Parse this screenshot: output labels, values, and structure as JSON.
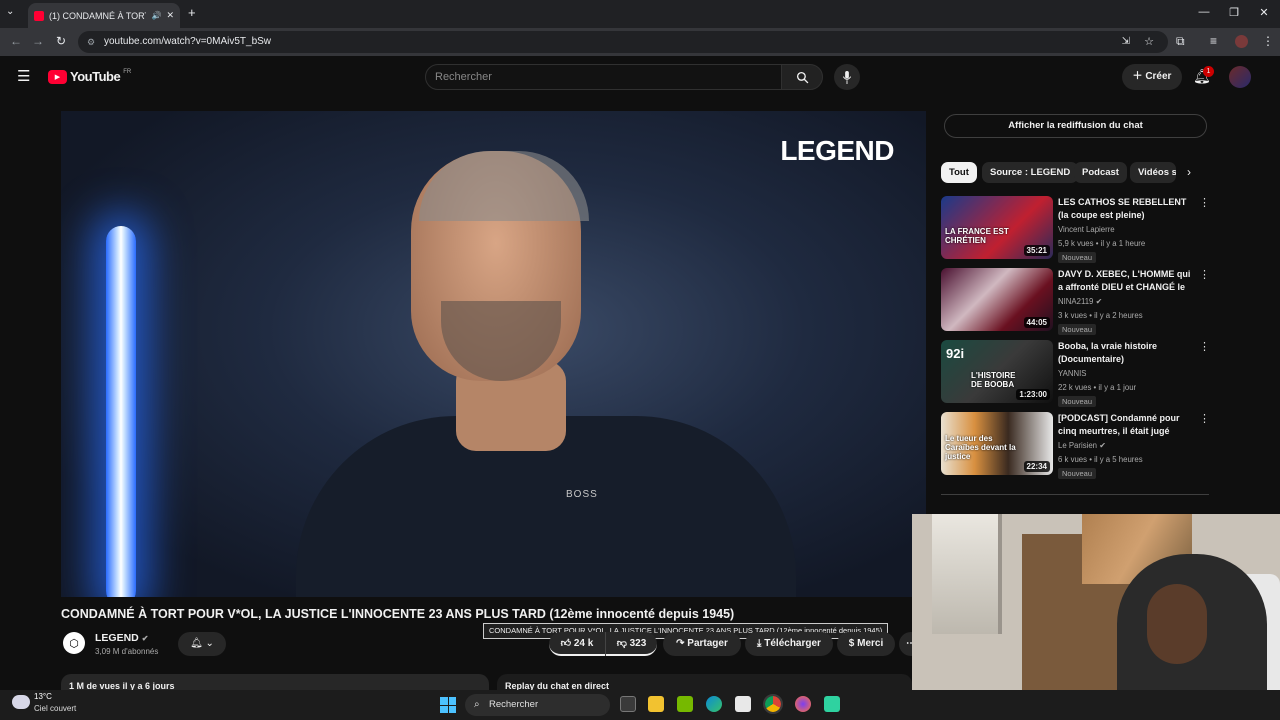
{
  "browser": {
    "tab_title": "(1) CONDAMNÉ À TORT PO",
    "url": "youtube.com/watch?v=0MAiv5T_bSw"
  },
  "youtube": {
    "logo_text": "YouTube",
    "region": "FR",
    "search_placeholder": "Rechercher",
    "create_label": "Créer",
    "notif_count": "1"
  },
  "video": {
    "overlay_logo": "LEGEND",
    "shirt_text": "BOSS",
    "title": "CONDAMNÉ À TORT POUR V*OL, LA JUSTICE L'INNOCENTE 23 ANS PLUS TARD (12ème innocenté depuis 1945)",
    "tooltip": "CONDAMNÉ À TORT POUR V*OL, LA JUSTICE L'INNOCENTE 23 ANS PLUS TARD (12ème innocenté depuis 1945)",
    "channel": "LEGEND",
    "subscribers": "3,09 M d'abonnés",
    "likes": "24 k",
    "dislikes": "323",
    "share": "Partager",
    "download": "Télécharger",
    "thanks": "Merci",
    "views_date": "1 M de vues  il y a 6 jours",
    "chat_replay": "Replay du chat en direct"
  },
  "sidebar": {
    "chat_button": "Afficher la rediffusion du chat",
    "chips": [
      "Tout",
      "Source : LEGEND",
      "Podcast",
      "Vidéos s"
    ],
    "recommendations": [
      {
        "title": "LES CATHOS SE REBELLENT (la coupe est pleine)",
        "channel": "Vincent Lapierre",
        "views": "5,9 k vues • il y a 1 heure",
        "badge": "Nouveau",
        "duration": "35:21",
        "thumb_text": "LA FRANCE EST CHRÉTIEN"
      },
      {
        "title": "DAVY D. XEBEC, L'HOMME qui a affronté DIEU et CHANGÉ le ...",
        "channel": "NINA2119",
        "views": "3 k vues • il y a 2 heures",
        "badge": "Nouveau",
        "duration": "44:05",
        "thumb_text": ""
      },
      {
        "title": "Booba, la vraie histoire (Documentaire)",
        "channel": "YANNIS",
        "views": "22 k vues • il y a 1 jour",
        "badge": "Nouveau",
        "duration": "1:23:00",
        "thumb_text": "L'HISTOIRE DE BOOBA"
      },
      {
        "title": "[PODCAST] Condamné pour cinq meurtres, il était jugé pou...",
        "channel": "Le Parisien",
        "views": "6 k vues • il y a 5 heures",
        "badge": "Nouveau",
        "duration": "22:34",
        "thumb_text": "Le tueur des Caraïbes devant la justice"
      }
    ]
  },
  "taskbar": {
    "temp": "13°C",
    "weather": "Ciel couvert",
    "search_label": "Rechercher"
  },
  "colors": {
    "yt_red": "#ff0033",
    "bg": "#0f0f0f"
  }
}
